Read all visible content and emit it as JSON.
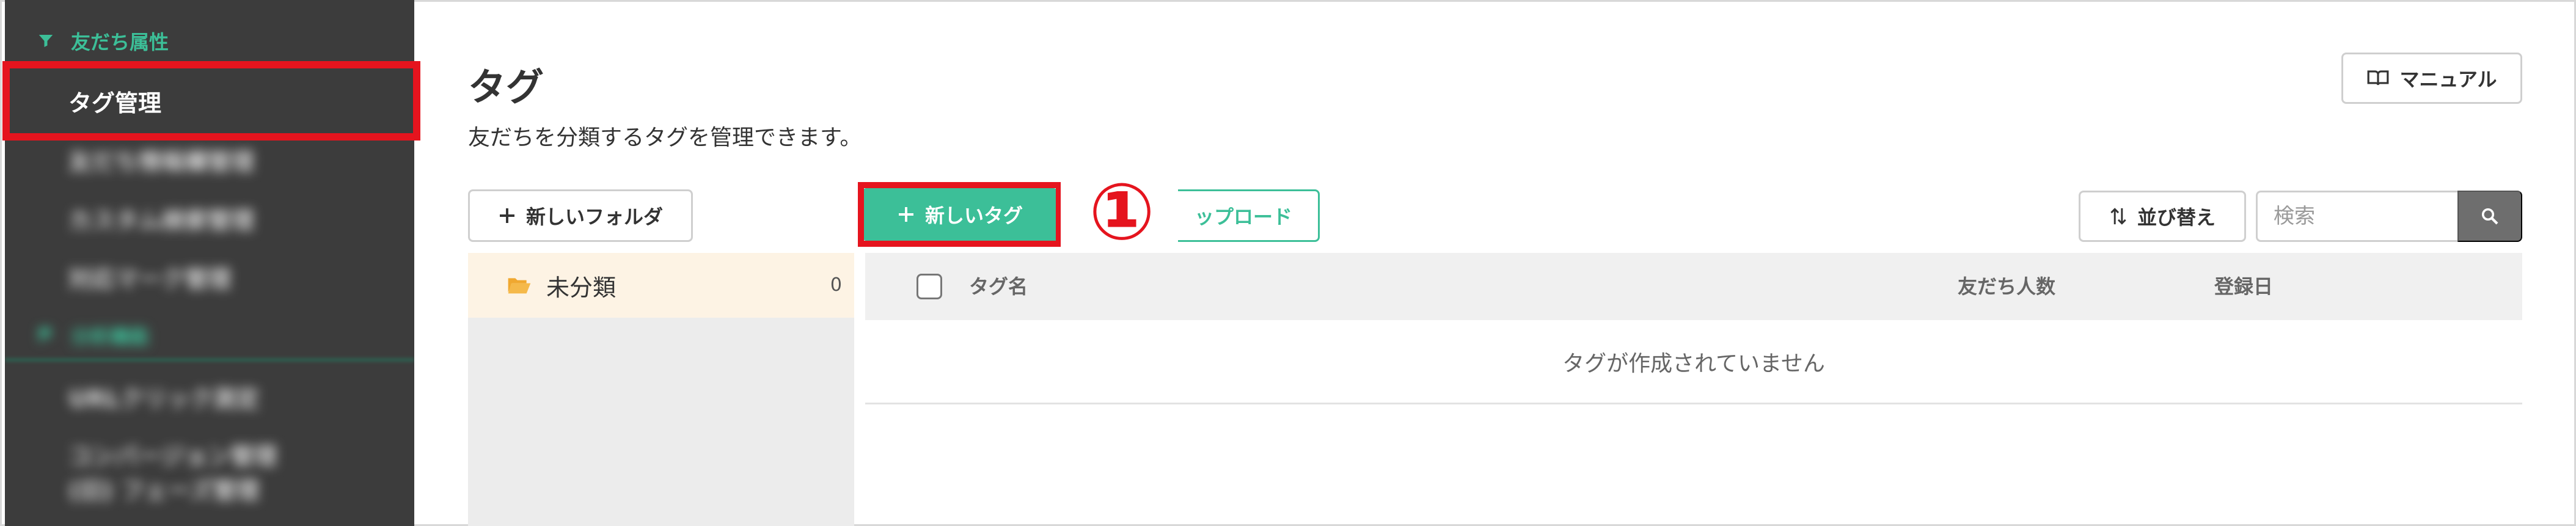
{
  "sidebar": {
    "section_friend_attr": "友だち属性",
    "items": [
      {
        "label": "タグ管理",
        "selected": true
      },
      {
        "label": "友だち情報欄管理",
        "blurred": true
      },
      {
        "label": "カスタム検索管理",
        "blurred": true
      },
      {
        "label": "対応マーク管理",
        "blurred": true
      }
    ],
    "section_analysis": "分析機能",
    "items_analysis": [
      {
        "label": "URLクリック測定",
        "blurred": true
      },
      {
        "label": "コンバージョン管理",
        "blurred": true
      },
      {
        "label": "(旧) フェーズ管理",
        "blurred": true
      }
    ]
  },
  "page": {
    "title": "タグ",
    "description": "友だちを分類するタグを管理できます。"
  },
  "toolbar": {
    "manual_label": "マニュアル",
    "new_folder_label": "新しいフォルダ",
    "new_tag_label": "新しいタグ",
    "upload_label": "ップロード",
    "step_badge": "①",
    "sort_label": "並び替え",
    "search_placeholder": "検索"
  },
  "folders": [
    {
      "name": "未分類",
      "count": "0"
    }
  ],
  "table": {
    "columns": [
      "タグ名",
      "友だち人数",
      "登録日"
    ],
    "empty_message": "タグが作成されていません"
  },
  "colors": {
    "accent": "#3cbf98",
    "sidebar_bg": "#3c3c3c",
    "highlight": "#e5141e",
    "folder_selected_bg": "#fdf3e4",
    "folder_icon": "#f0a830"
  }
}
